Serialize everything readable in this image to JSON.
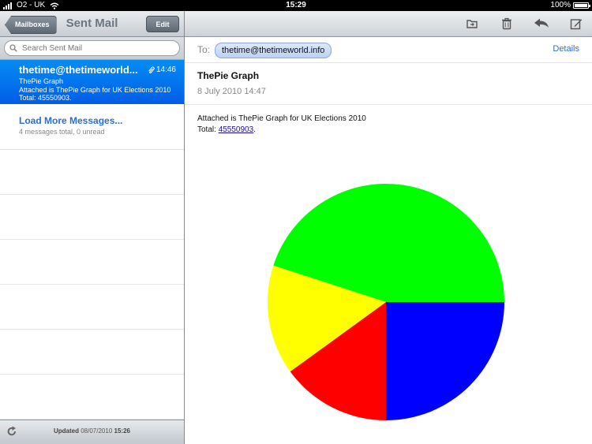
{
  "status": {
    "carrier": "O2 - UK",
    "time": "15:29",
    "battery": "100%"
  },
  "sidebar": {
    "back_label": "Mailboxes",
    "title": "Sent Mail",
    "edit_label": "Edit",
    "search_placeholder": "Search Sent Mail",
    "selected_message": {
      "sender": "thetime@thetimeworld...",
      "time": "14:46",
      "subject": "ThePie Graph",
      "preview": "Attached is ThePie Graph for UK Elections 2010 Total: 45550903."
    },
    "load_more": {
      "label": "Load More Messages...",
      "sub": "4 messages total, 0 unread"
    },
    "updated_label": "Updated",
    "updated_date": "08/07/2010",
    "updated_time": "15:26"
  },
  "message": {
    "to_label": "To:",
    "to_address": "thetime@thetimeworld.info",
    "details_label": "Details",
    "subject": "ThePie Graph",
    "date": "8 July 2010 14:47",
    "body_line1": "Attached is ThePie Graph for UK Elections 2010",
    "body_total_label": "Total:",
    "body_total_value": "45550903",
    "body_period": "."
  },
  "chart_data": {
    "type": "pie",
    "values": [
      45,
      25,
      15,
      15
    ],
    "colors": [
      "#00ff00",
      "#0000ff",
      "#ff0000",
      "#ffff00"
    ],
    "start_angle_deg": 0
  },
  "colors": {
    "accent": "#2a6dd4",
    "selected_row": "#0a7af0"
  }
}
